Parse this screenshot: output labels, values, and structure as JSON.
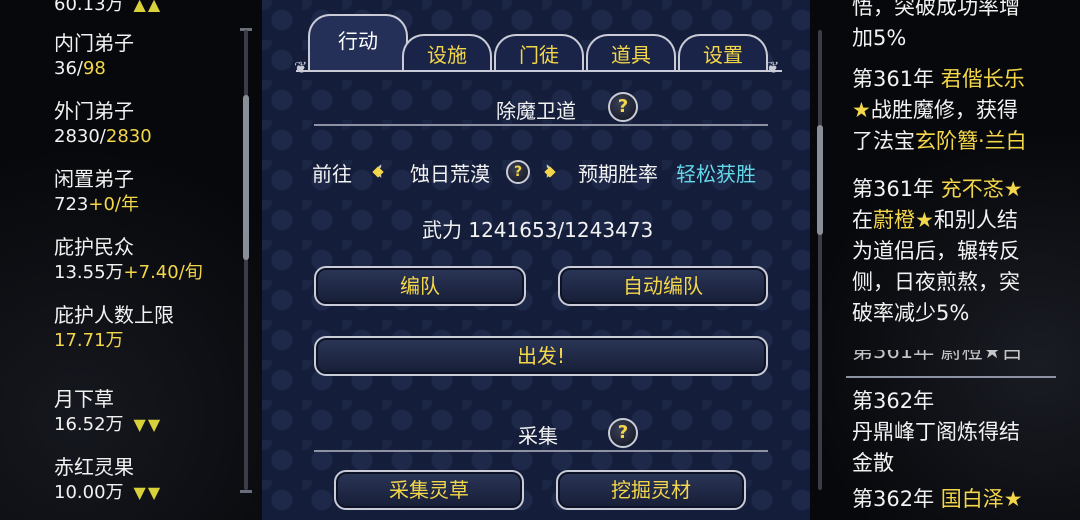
{
  "left": {
    "top_value": "60.13万",
    "stats": [
      {
        "label": "内门弟子",
        "value_white": "36/",
        "value_color": "98",
        "color": "yellow"
      },
      {
        "label": "外门弟子",
        "value_white": "2830/",
        "value_color": "2830",
        "color": "yellow"
      },
      {
        "label": "闲置弟子",
        "value_white": "723",
        "value_color": "+0/年",
        "color": "yellow"
      },
      {
        "label": "庇护民众",
        "value_white": "13.55万",
        "value_color": "+7.40/旬",
        "color": "yellow"
      },
      {
        "label": "庇护人数上限",
        "value_white": "",
        "value_color": "17.71万",
        "color": "yellow"
      }
    ],
    "resources": [
      {
        "label": "月下草",
        "value": "16.52万",
        "trend": "▼▼",
        "label_color": "white"
      },
      {
        "label": "赤红灵果",
        "value": "10.00万",
        "trend": "▼▼",
        "label_color": "green"
      }
    ],
    "top_trend": "▲▲"
  },
  "tabs": [
    {
      "label": "行动",
      "active": true
    },
    {
      "label": "设施",
      "active": false
    },
    {
      "label": "门徒",
      "active": false
    },
    {
      "label": "道具",
      "active": false
    },
    {
      "label": "设置",
      "active": false
    }
  ],
  "mission": {
    "title": "除魔卫道",
    "help": "?",
    "goto_label": "前往",
    "destination": "蚀日荒漠",
    "rate_label": "预期胜率",
    "rate_value": "轻松获胜",
    "power": "武力 1241653/1243473",
    "formation_button": "编队",
    "auto_formation_button": "自动编队",
    "depart_button": "出发!"
  },
  "gather": {
    "title": "采集",
    "help": "?",
    "herbs_button": "采集灵草",
    "mine_button": "挖掘灵材"
  },
  "log": {
    "lines_top": [
      {
        "text": "悟，突破成功率增"
      },
      {
        "text": "加5%"
      }
    ],
    "entry1": {
      "year": "第361年",
      "name": "君偕长乐",
      "l2_star": "★",
      "l2": "战胜魔修，获得",
      "l3_pre": "了法宝",
      "l3_item": "玄阶簪·兰白"
    },
    "entry2": {
      "year": "第361年",
      "name": "充不忞",
      "star": "★",
      "l2_pre": "在",
      "l2_name": "蔚橙",
      "l2_star": "★",
      "l2_post": "和别人结",
      "l3": "为道侣后，辗转反",
      "l4": "侧，日夜煎熬，突",
      "l5": "破率减少5%"
    },
    "entry3_partial": "第361年 蔚橙★白",
    "entry4": {
      "year": "第362年",
      "l2": "丹鼎峰丁阁炼得结",
      "l3": "金散"
    },
    "entry5": {
      "year": "第362年",
      "name": "国白泽",
      "star": "★"
    }
  },
  "colors": {
    "accent": "#f3d64a",
    "bonus": "#7fe36a",
    "cyan": "#63d6e8",
    "panel": "#141d3a"
  }
}
